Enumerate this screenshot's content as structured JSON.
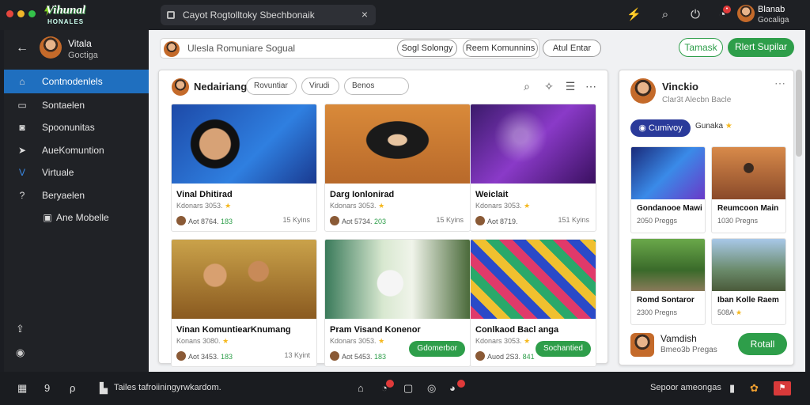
{
  "topbar": {
    "logo_line1": "Vihunal",
    "logo_line2": "HONALES",
    "url": "Cayot Rogtolltoky Sbechbonaik",
    "url_close": "×",
    "notify_badge": "•",
    "user_name": "Blanab",
    "user_sub": "Gocaliga"
  },
  "sidebar": {
    "back_icon": "arrow-left-icon",
    "user_name": "Vitala",
    "user_sub": "Goctiga",
    "items": [
      {
        "label": "Contnodenlels",
        "icon": "home-icon",
        "active": true
      },
      {
        "label": "Sontaelen",
        "icon": "chat-icon",
        "active": false
      },
      {
        "label": "Spoonunitas",
        "icon": "chat-bubble-icon",
        "active": false
      },
      {
        "label": "AueKomuntion",
        "icon": "share-icon",
        "active": false
      },
      {
        "label": "Virtuale",
        "icon": "v-icon",
        "active": false
      },
      {
        "label": "Beryaelen",
        "icon": "help-icon",
        "active": false
      },
      {
        "label": "Ane Mobelle",
        "icon": "device-icon",
        "active": false
      }
    ]
  },
  "main": {
    "search_value": "Ulesla Romuniare Sogual",
    "search_clear": "×",
    "filters": [
      "Sogl Solongy",
      "Reem Komunnins",
      "Atul Entar"
    ],
    "btn_secondary": "Tamask",
    "btn_primary": "Rlert Supilar"
  },
  "feed": {
    "title": "Nedairiang",
    "chips": [
      "Rovuntiar",
      "Virudi",
      "Benos"
    ],
    "cards": [
      {
        "title": "Vinal Dhitirad",
        "sub": "Kdonars 3053.",
        "meta": "Aot 8764.",
        "meta_hl": "183",
        "right": "15 Kyins",
        "button": ""
      },
      {
        "title": "Darg Ionlonirad",
        "sub": "Kdonars 3053.",
        "meta": "Aot 5734.",
        "meta_hl": "203",
        "right": "15 Kyins",
        "button": ""
      },
      {
        "title": "Weiclait",
        "sub": "Kdonars 3053.",
        "meta": "Aot 8719.",
        "meta_hl": "",
        "right": "151 Kyins",
        "button": ""
      },
      {
        "title": "Vinan KomuntiearKnumang",
        "sub": "Konans 3080.",
        "meta": "Aot 3453.",
        "meta_hl": "183",
        "right": "13 Kyint",
        "button": ""
      },
      {
        "title": "Pram Visand Konenor",
        "sub": "Kdonars 3053.",
        "meta": "Aot 5453.",
        "meta_hl": "183",
        "right": "",
        "button": "Gdomerbor"
      },
      {
        "title": "Conlkaod Bacl anga",
        "sub": "Kdonars 3053.",
        "meta": "Auod 2S3.",
        "meta_hl": "841",
        "right": "",
        "button": "Sochantied"
      }
    ]
  },
  "right_panel": {
    "name": "Vinckio",
    "sub": "Clar3t Alecbn Bacle",
    "follow_label": "Cumivoy",
    "tag": "Gunaka",
    "minis": [
      {
        "title": "Gondanooe Mawi",
        "sub": "2050 Preggs"
      },
      {
        "title": "Reumcoon Main",
        "sub": "1030 Pregns"
      },
      {
        "title": "Romd Sontaror",
        "sub": "2300 Pregns"
      },
      {
        "title": "Iban Kolle Raem",
        "sub": "508A"
      }
    ],
    "footer_name": "Vamdish",
    "footer_sub": "Bmeo3b Pregas",
    "footer_button": "Rotall"
  },
  "taskbar": {
    "search_text": "Tailes tafroiiningyrwkardom.",
    "right_text": "Sepoor ameongas"
  },
  "colors": {
    "accent_blue": "#1f6fbf",
    "accent_green": "#2e9e4a",
    "follow_navy": "#2a3a9a"
  }
}
